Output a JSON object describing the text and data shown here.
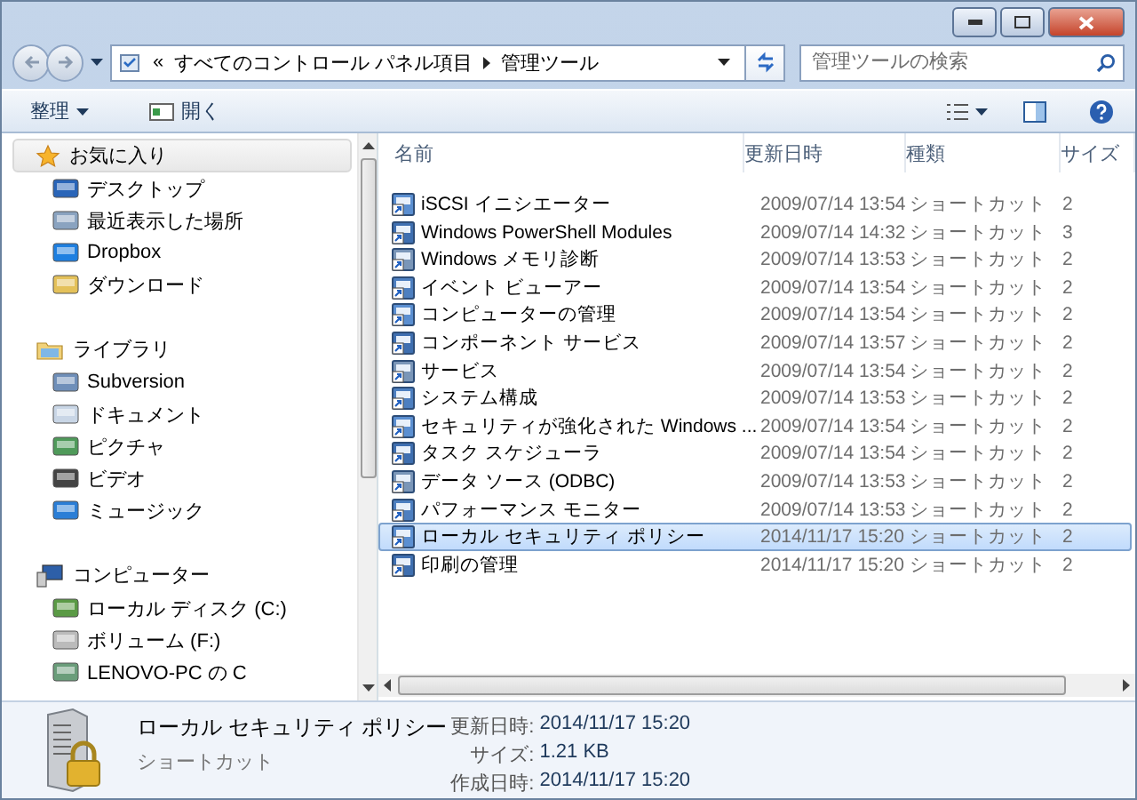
{
  "address_bar": {
    "overflow": "«",
    "crumbs": [
      "すべてのコントロール パネル項目",
      "管理ツール"
    ]
  },
  "search": {
    "placeholder": "管理ツールの検索"
  },
  "toolbar": {
    "organize": "整理",
    "open": "開く"
  },
  "nav": [
    {
      "header": {
        "label": "お気に入り",
        "selected": true
      },
      "items": [
        {
          "label": "デスクトップ",
          "selected": false
        },
        {
          "label": "最近表示した場所",
          "selected": false
        },
        {
          "label": "Dropbox",
          "selected": false
        },
        {
          "label": "ダウンロード",
          "selected": false
        }
      ]
    },
    {
      "header": {
        "label": "ライブラリ",
        "selected": false
      },
      "items": [
        {
          "label": "Subversion",
          "selected": false
        },
        {
          "label": "ドキュメント",
          "selected": false
        },
        {
          "label": "ピクチャ",
          "selected": false
        },
        {
          "label": "ビデオ",
          "selected": false
        },
        {
          "label": "ミュージック",
          "selected": false
        }
      ]
    },
    {
      "header": {
        "label": "コンピューター",
        "selected": false
      },
      "items": [
        {
          "label": "ローカル ディスク (C:)",
          "selected": false
        },
        {
          "label": "ボリューム (F:)",
          "selected": false
        },
        {
          "label": "LENOVO-PC の C",
          "selected": false
        }
      ]
    }
  ],
  "table": {
    "columns": [
      "名前",
      "更新日時",
      "種類",
      "サイズ"
    ],
    "rows": [
      {
        "name": "iSCSI イニシエーター",
        "date": "2009/07/14 13:54",
        "type": "ショートカット",
        "size": "2",
        "selected": false
      },
      {
        "name": "Windows PowerShell Modules",
        "date": "2009/07/14 14:32",
        "type": "ショートカット",
        "size": "3",
        "selected": false
      },
      {
        "name": "Windows メモリ診断",
        "date": "2009/07/14 13:53",
        "type": "ショートカット",
        "size": "2",
        "selected": false
      },
      {
        "name": "イベント ビューアー",
        "date": "2009/07/14 13:54",
        "type": "ショートカット",
        "size": "2",
        "selected": false
      },
      {
        "name": "コンピューターの管理",
        "date": "2009/07/14 13:54",
        "type": "ショートカット",
        "size": "2",
        "selected": false
      },
      {
        "name": "コンポーネント サービス",
        "date": "2009/07/14 13:57",
        "type": "ショートカット",
        "size": "2",
        "selected": false
      },
      {
        "name": "サービス",
        "date": "2009/07/14 13:54",
        "type": "ショートカット",
        "size": "2",
        "selected": false
      },
      {
        "name": "システム構成",
        "date": "2009/07/14 13:53",
        "type": "ショートカット",
        "size": "2",
        "selected": false
      },
      {
        "name": "セキュリティが強化された Windows ...",
        "date": "2009/07/14 13:54",
        "type": "ショートカット",
        "size": "2",
        "selected": false
      },
      {
        "name": "タスク スケジューラ",
        "date": "2009/07/14 13:54",
        "type": "ショートカット",
        "size": "2",
        "selected": false
      },
      {
        "name": "データ ソース (ODBC)",
        "date": "2009/07/14 13:53",
        "type": "ショートカット",
        "size": "2",
        "selected": false
      },
      {
        "name": "パフォーマンス モニター",
        "date": "2009/07/14 13:53",
        "type": "ショートカット",
        "size": "2",
        "selected": false
      },
      {
        "name": "ローカル セキュリティ ポリシー",
        "date": "2014/11/17 15:20",
        "type": "ショートカット",
        "size": "2",
        "selected": true
      },
      {
        "name": "印刷の管理",
        "date": "2014/11/17 15:20",
        "type": "ショートカット",
        "size": "2",
        "selected": false
      }
    ]
  },
  "details": {
    "name": "ローカル セキュリティ ポリシー",
    "type": "ショートカット",
    "fields": [
      {
        "label": "更新日時:",
        "value": "2014/11/17 15:20"
      },
      {
        "label": "サイズ:",
        "value": "1.21 KB"
      },
      {
        "label": "作成日時:",
        "value": "2014/11/17 15:20"
      }
    ]
  }
}
